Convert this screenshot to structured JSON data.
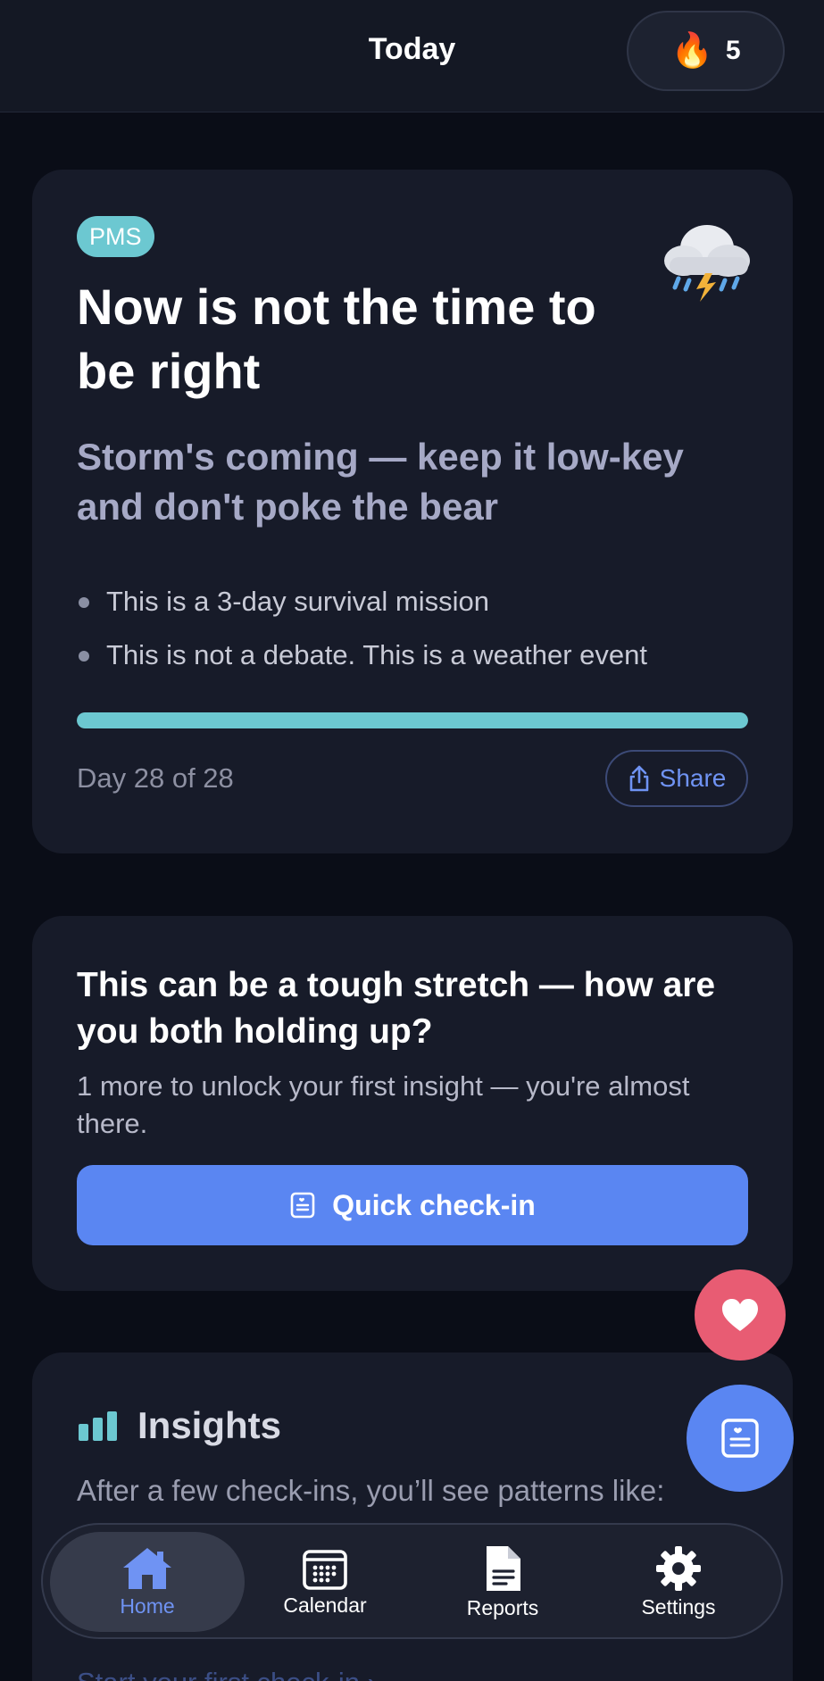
{
  "header": {
    "title": "Today",
    "streak": {
      "icon": "flame-icon",
      "emoji": "🔥",
      "count": "5"
    }
  },
  "phase_card": {
    "badge": "PMS",
    "weather_icon": "storm-cloud-icon",
    "title": "Now is not the time to be right",
    "subtitle": "Storm's coming — keep it low-key and don't poke the bear",
    "bullets": [
      "This is a 3-day survival mission",
      "This is not a debate. This is a weather event"
    ],
    "progress": {
      "current": 28,
      "total": 28,
      "fraction": 1.0
    },
    "day_label": "Day 28 of 28",
    "share_label": "Share"
  },
  "checkin_card": {
    "title": "This can be a tough stretch — how are you both holding up?",
    "subtitle": "1 more to unlock your first insight — you're almost there.",
    "button_label": "Quick check-in"
  },
  "insights_card": {
    "title": "Insights",
    "subtitle": "After a few check-ins, you’ll see patterns like:",
    "link": "Start your first check-in"
  },
  "nav": {
    "items": [
      {
        "label": "Home",
        "icon": "home-icon",
        "active": true
      },
      {
        "label": "Calendar",
        "icon": "calendar-icon",
        "active": false
      },
      {
        "label": "Reports",
        "icon": "document-icon",
        "active": false
      },
      {
        "label": "Settings",
        "icon": "gear-icon",
        "active": false
      }
    ]
  },
  "colors": {
    "background": "#0a0d17",
    "card": "#171b29",
    "teal": "#6cc8d1",
    "blue": "#5a86f2",
    "pink": "#e85c73",
    "link_blue": "#6f93f3"
  }
}
